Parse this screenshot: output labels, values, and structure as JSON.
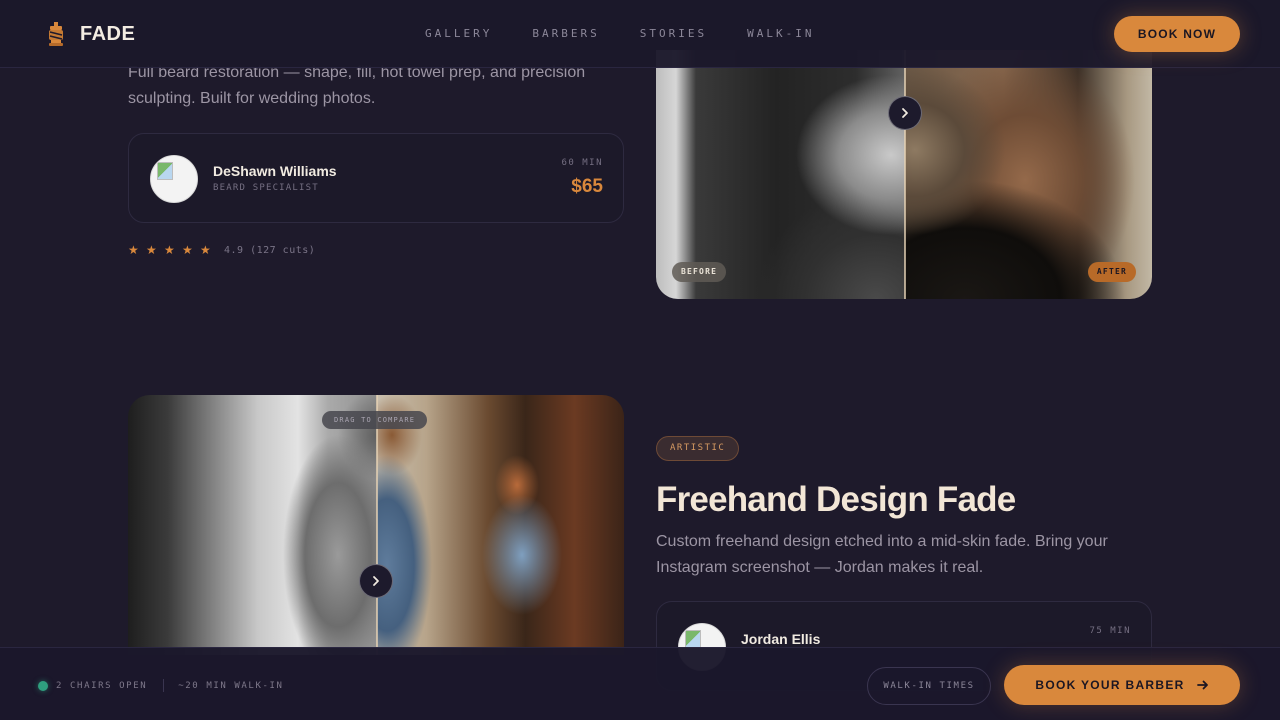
{
  "header": {
    "logo_text": "FADE",
    "logo_icon": "barber-pole-icon",
    "nav": [
      "GALLERY",
      "BARBERS",
      "STORIES",
      "WALK-IN"
    ],
    "book_now": "BOOK NOW"
  },
  "section1": {
    "description": "Full beard restoration — shape, fill, hot towel prep, and precision sculpting. Built for wedding photos.",
    "barber": {
      "name": "DeShawn Williams",
      "role": "BEARD SPECIALIST",
      "duration": "60 MIN",
      "price": "$65"
    },
    "rating": {
      "stars": 5,
      "text": "4.9 (127 cuts)"
    },
    "compare": {
      "before_label": "BEFORE",
      "after_label": "AFTER",
      "handle_icon": "chevron-right-icon"
    }
  },
  "section2": {
    "badge": "ARTISTIC",
    "title": "Freehand Design Fade",
    "description": "Custom freehand design etched into a mid-skin fade. Bring your Instagram screenshot — Jordan makes it real.",
    "barber": {
      "name": "Jordan Ellis",
      "duration": "75 MIN"
    },
    "compare": {
      "hint": "DRAG TO COMPARE",
      "handle_icon": "chevron-right-icon"
    }
  },
  "bottom_bar": {
    "chairs": "2 CHAIRS OPEN",
    "wait": "~20 MIN WALK-IN",
    "walkin_times": "WALK-IN TIMES",
    "book_barber": "BOOK YOUR BARBER",
    "status_color": "#2f9f7f"
  },
  "colors": {
    "accent": "#d9883c",
    "background": "#1e1a2b",
    "text": "#ece4d8"
  }
}
